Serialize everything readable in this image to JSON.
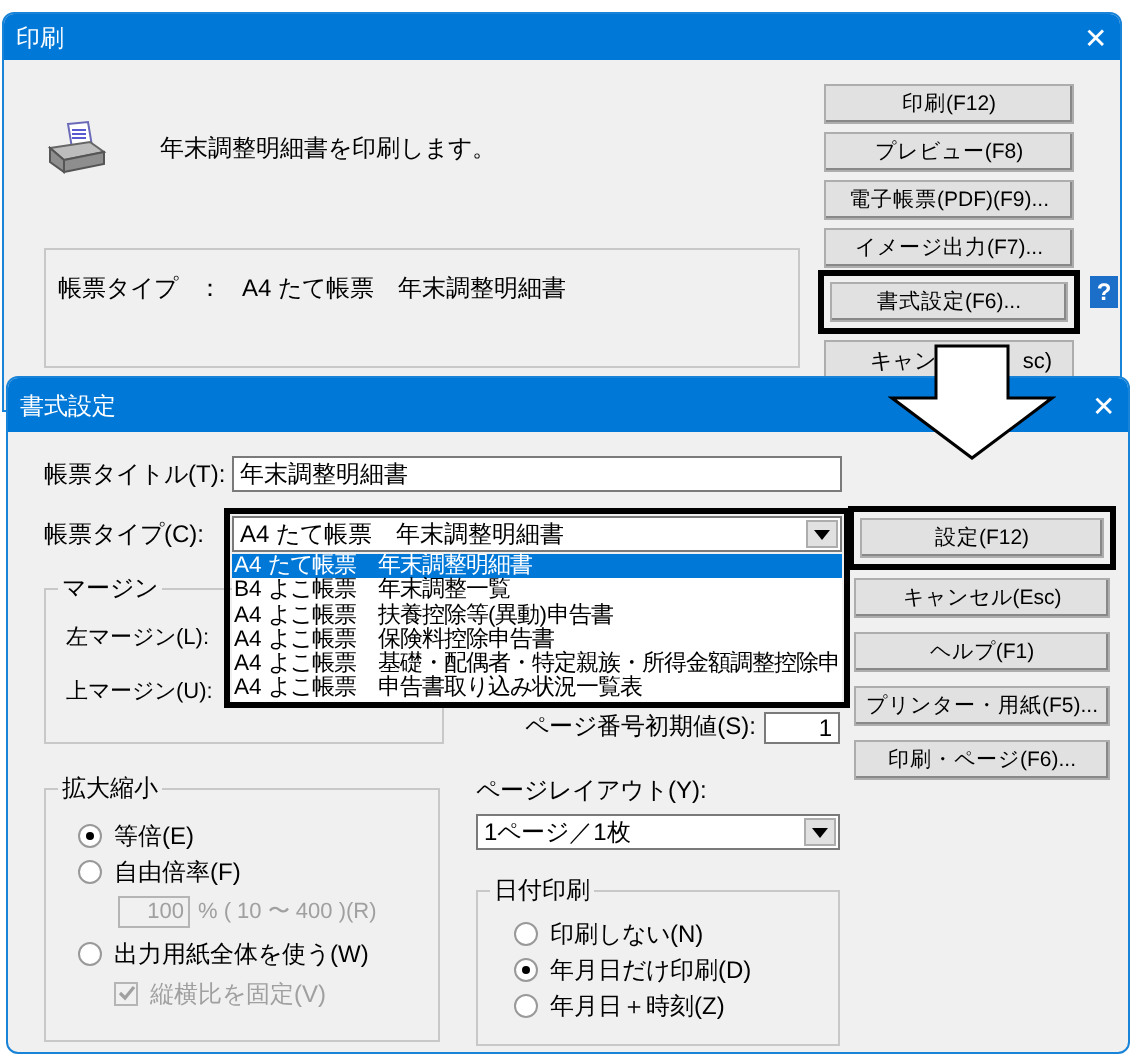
{
  "print_dialog": {
    "title": "印刷",
    "close": "✕",
    "message": "年末調整明細書を印刷します。",
    "buttons": [
      {
        "label": "印刷(F12)",
        "highlighted": false
      },
      {
        "label": "プレビュー(F8)",
        "highlighted": false
      },
      {
        "label": "電子帳票(PDF)(F9)...",
        "highlighted": false
      },
      {
        "label": "イメージ出力(F7)...",
        "highlighted": false
      },
      {
        "label": "書式設定(F6)...",
        "highlighted": true
      }
    ],
    "help_icon": "?",
    "cancel_button": {
      "visible_start": "キャン",
      "visible_end": "sc)"
    },
    "form_type": {
      "label": "帳票タイプ",
      "separator": "：",
      "value": "A4 たて帳票　年末調整明細書"
    }
  },
  "format_dialog": {
    "title": "書式設定",
    "close": "✕",
    "title_field": {
      "label": "帳票タイトル(T):",
      "value": "年末調整明細書"
    },
    "type_field": {
      "label": "帳票タイプ(C):",
      "value": "A4 たて帳票　年末調整明細書",
      "highlighted": true,
      "options": [
        {
          "text": "A4 たて帳票　年末調整明細書",
          "selected": true
        },
        {
          "text": "B4 よこ帳票　年末調整一覧",
          "selected": false
        },
        {
          "text": "A4 よこ帳票　扶養控除等(異動)申告書",
          "selected": false
        },
        {
          "text": "A4 よこ帳票　保険料控除申告書",
          "selected": false
        },
        {
          "text": "A4 よこ帳票　基礎・配偶者・特定親族・所得金額調整控除申",
          "selected": false
        },
        {
          "text": "A4 よこ帳票　申告書取り込み状況一覧表",
          "selected": false
        }
      ]
    },
    "margin_group": {
      "title": "マージン",
      "left_label": "左マージン(L):",
      "top_label": "上マージン(U):"
    },
    "page_number": {
      "label": "ページ番号初期値(S):",
      "value": "1"
    },
    "scale_group": {
      "title": "拡大縮小",
      "options": [
        {
          "label": "等倍(E)",
          "selected": true
        },
        {
          "label": "自由倍率(F)",
          "selected": false
        },
        {
          "label": "出力用紙全体を使う(W)",
          "selected": false
        }
      ],
      "ratio_value": "100",
      "ratio_range": "% ( 10 〜 400 )(R)",
      "ratio_disabled": true,
      "keep_aspect": {
        "label": "縦横比を固定(V)",
        "checked": true,
        "disabled": true
      }
    },
    "page_layout": {
      "label": "ページレイアウト(Y):",
      "value": "1ページ／1枚"
    },
    "date_group": {
      "title": "日付印刷",
      "options": [
        {
          "label": "印刷しない(N)",
          "selected": false
        },
        {
          "label": "年月日だけ印刷(D)",
          "selected": true
        },
        {
          "label": "年月日＋時刻(Z)",
          "selected": false
        }
      ]
    },
    "buttons": [
      {
        "label": "設定(F12)",
        "highlighted": true
      },
      {
        "label": "キャンセル(Esc)",
        "highlighted": false
      },
      {
        "label": "ヘルプ(F1)",
        "highlighted": false
      },
      {
        "label": "プリンター・用紙(F5)...",
        "highlighted": false
      },
      {
        "label": "印刷・ページ(F6)...",
        "highlighted": false
      }
    ]
  }
}
